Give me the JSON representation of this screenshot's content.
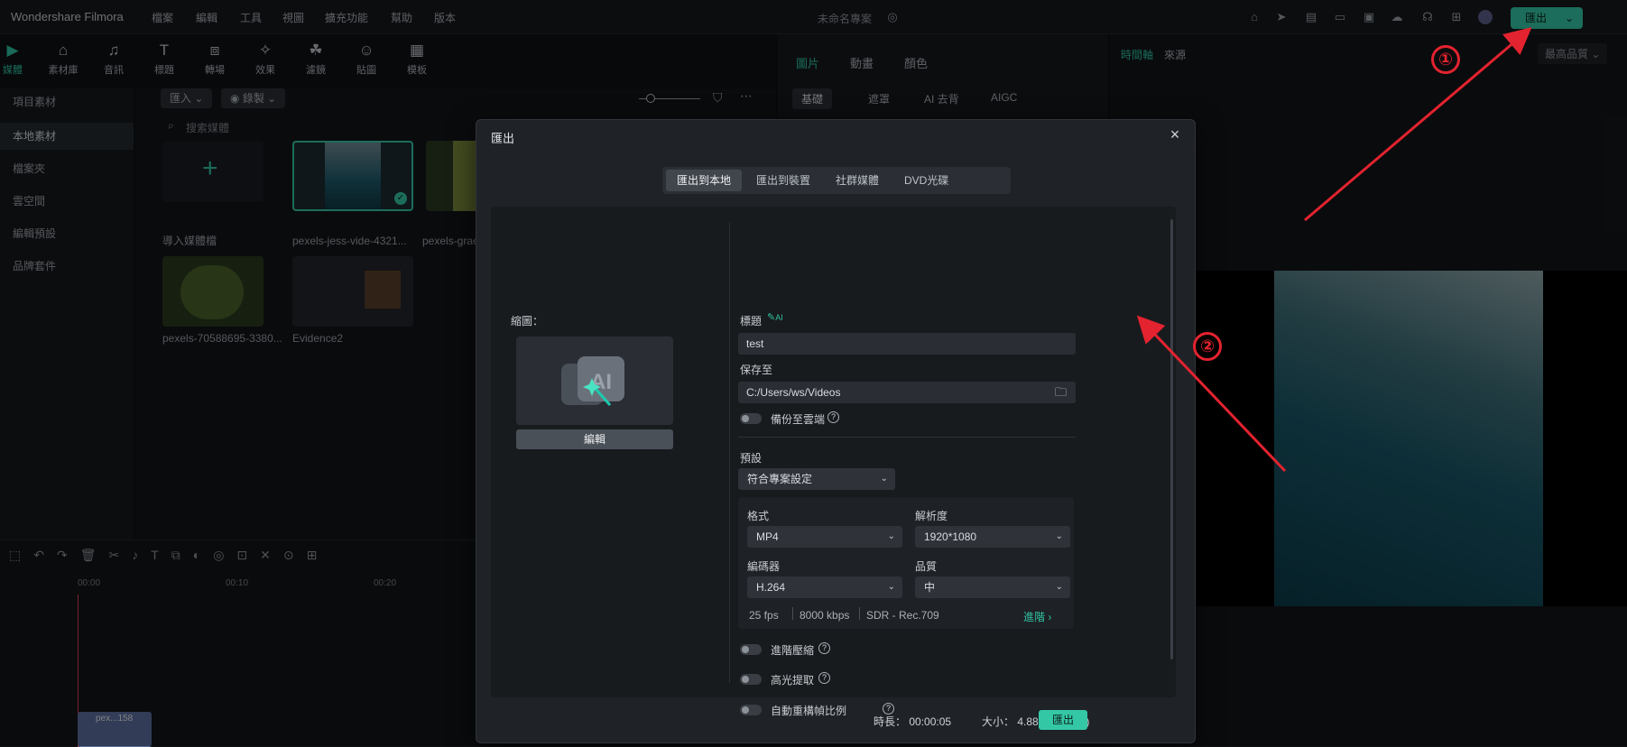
{
  "topbar": {
    "app_title": "Wondershare Filmora",
    "menus": [
      "檔案",
      "編輯",
      "工具",
      "視圖",
      "擴充功能",
      "幫助",
      "版本"
    ],
    "project_name": "未命名專案",
    "export_label": "匯出"
  },
  "toolbar": {
    "tools": [
      "媒體",
      "素材庫",
      "音訊",
      "標題",
      "轉場",
      "效果",
      "濾鏡",
      "貼圖",
      "模板"
    ]
  },
  "leftnav": {
    "items": [
      "項目素材",
      "本地素材",
      "檔案夾",
      "雲空間",
      "編輯預設",
      "品牌套件"
    ]
  },
  "media": {
    "import_label": "匯入",
    "record_label": "錄製",
    "search_placeholder": "搜索媒體",
    "import_tile_label": "導入媒體檔",
    "items": [
      "pexels-jess-vide-4321...",
      "pexels-grae",
      "pexels-70588695-3380...",
      "Evidence2"
    ]
  },
  "props": {
    "tabs": [
      "圖片",
      "動畫",
      "顏色"
    ],
    "subtabs": [
      "基礎",
      "遮罩",
      "AI 去背",
      "AIGC"
    ]
  },
  "preview": {
    "tabs": [
      "時間軸",
      "來源"
    ],
    "quality": "最高品質"
  },
  "timeline": {
    "ticks": [
      "00:00",
      "00:10",
      "00:20"
    ],
    "clip_label": "pex...158"
  },
  "dialog": {
    "title": "匯出",
    "tabs": [
      "匯出到本地",
      "匯出到裝置",
      "社群媒體",
      "DVD光碟"
    ],
    "thumbnail_label": "縮圖：",
    "edit_button": "編輯",
    "title_label": "標題",
    "ai_badge": "AI",
    "title_value": "test",
    "save_to_label": "保存至",
    "save_path": "C:/Users/ws/Videos",
    "backup_cloud_label": "備份至雲端",
    "preset_label": "預設",
    "preset_value": "符合專案設定",
    "format_label": "格式",
    "format_value": "MP4",
    "resolution_label": "解析度",
    "resolution_value": "1920*1080",
    "encoder_label": "編碼器",
    "encoder_value": "H.264",
    "quality_label": "品質",
    "quality_value": "中",
    "summary": [
      "25 fps",
      "8000 kbps",
      "SDR - Rec.709"
    ],
    "advanced_label": "進階",
    "adv_compress_label": "進階壓縮",
    "highlight_label": "高光提取",
    "auto_reframe_label": "自動重構幀比例",
    "duration_label": "時長：",
    "duration_value": "00:00:05",
    "size_label": "大小：",
    "size_value": "4.88 MB (預估)",
    "export_button": "匯出"
  },
  "annotations": {
    "marker1": "①",
    "marker2": "②",
    "color": "#e3232f"
  }
}
